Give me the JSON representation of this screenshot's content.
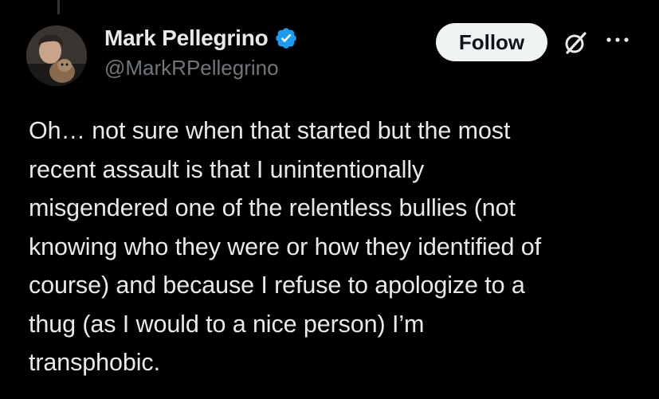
{
  "tweet": {
    "author": {
      "display_name": "Mark Pellegrino",
      "handle": "@MarkRPellegrino",
      "verified": true,
      "verified_color": "#1d9bf0"
    },
    "follow_label": "Follow",
    "icons": {
      "avatar": "avatar",
      "verified": "verified-badge-icon",
      "grok": "grok-icon",
      "more": "more-icon"
    },
    "text": "Oh… not sure when that started but the most\nrecent assault is that I unintentionally\nmisgendered one of the relentless bullies (not\nknowing who they were or how they identified of\ncourse) and because I refuse to apologize to a\nthug (as I would to a nice person) I’m\ntransphobic."
  },
  "colors": {
    "background": "#000000",
    "text_primary": "#e7e9ea",
    "text_secondary": "#71767b",
    "button_bg": "#eff3f4",
    "button_text": "#0f1419"
  }
}
